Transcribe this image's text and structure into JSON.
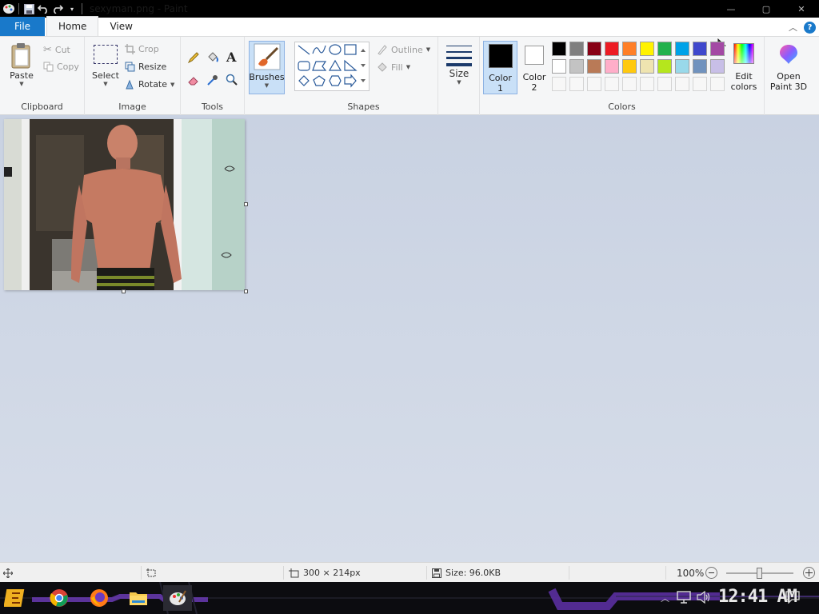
{
  "window": {
    "title": "sexyman.png - Paint",
    "minimize": "—",
    "maximize": "▢",
    "close": "✕"
  },
  "tabs": [
    {
      "label": "File"
    },
    {
      "label": "Home"
    },
    {
      "label": "View"
    }
  ],
  "help_label": "?",
  "clipboard": {
    "paste": "Paste",
    "cut": "Cut",
    "copy": "Copy",
    "group": "Clipboard"
  },
  "image": {
    "select": "Select",
    "crop": "Crop",
    "resize": "Resize",
    "rotate": "Rotate",
    "group": "Image"
  },
  "tools": {
    "group": "Tools",
    "text_glyph": "A"
  },
  "brushes": {
    "label": "Brushes"
  },
  "shapes": {
    "outline": "Outline",
    "fill": "Fill",
    "group": "Shapes"
  },
  "size": {
    "label": "Size"
  },
  "colors": {
    "color1_line1": "Color",
    "color1_line2": "1",
    "color2_line1": "Color",
    "color2_line2": "2",
    "edit_line1": "Edit",
    "edit_line2": "colors",
    "group": "Colors",
    "color1_value": "#000000",
    "color2_value": "#ffffff",
    "palette_row1": [
      "#000000",
      "#7f7f7f",
      "#880015",
      "#ed1c24",
      "#ff7f27",
      "#fff200",
      "#22b14c",
      "#00a2e8",
      "#3f48cc",
      "#a349a4"
    ],
    "palette_row2": [
      "#ffffff",
      "#c3c3c3",
      "#b97a57",
      "#ffaec9",
      "#ffc90e",
      "#efe4b0",
      "#b5e61d",
      "#99d9ea",
      "#7092be",
      "#c8bfe7"
    ]
  },
  "paint3d": {
    "line1": "Open",
    "line2": "Paint 3D"
  },
  "status": {
    "dimensions": "300 × 214px",
    "size": "Size: 96.0KB",
    "zoom": "100%"
  },
  "taskbar": {
    "clock": "12:41 AM"
  }
}
